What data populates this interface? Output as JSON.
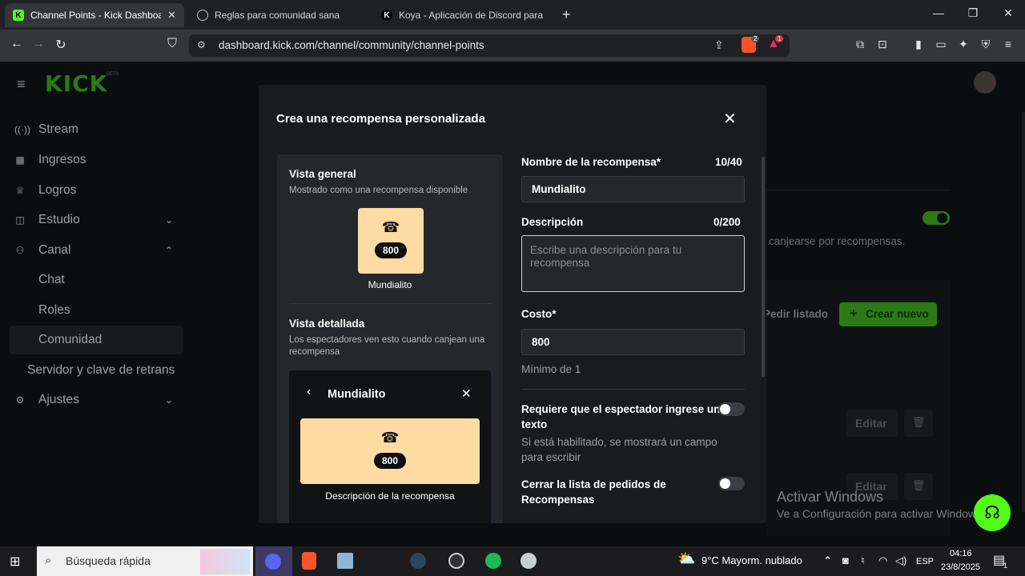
{
  "browser": {
    "tabs": [
      {
        "label": "Channel Points - Kick Dashboard",
        "favicon": "K",
        "active": true
      },
      {
        "label": "Reglas para comunidad sana",
        "favicon": "globe"
      },
      {
        "label": "Koya - Aplicación de Discord para la c",
        "favicon": "K"
      }
    ],
    "url": "dashboard.kick.com/channel/community/channel-points",
    "brave_badge": "2",
    "alert_badge": "1"
  },
  "sidebar": {
    "logo": "KICK",
    "logo_sup": "BETA",
    "items": [
      {
        "label": "Stream",
        "icon": "broadcast-icon"
      },
      {
        "label": "Ingresos",
        "icon": "chart-icon"
      },
      {
        "label": "Logros",
        "icon": "trophy-icon"
      },
      {
        "label": "Estudio",
        "icon": "studio-icon"
      },
      {
        "label": "Canal",
        "icon": "users-icon"
      },
      {
        "label": "Chat"
      },
      {
        "label": "Roles"
      },
      {
        "label": "Comunidad"
      },
      {
        "label": "Servidor y clave de retrans"
      },
      {
        "label": "Ajustes",
        "icon": "gear-icon"
      }
    ]
  },
  "background": {
    "redeem_text": "canjearse por recompensas.",
    "request_list_btn": "Pedir listado",
    "create_btn": "Crear nuevo",
    "edit_label": "Editar"
  },
  "modal": {
    "title": "Crea una recompensa personalizada",
    "overview_title": "Vista general",
    "overview_sub": "Mostrado como una recompensa disponible",
    "reward_cost": "800",
    "reward_name": "Mundialito",
    "detail_title": "Vista detallada",
    "detail_sub": "Los espectadores ven esto cuando canjean una recompensa",
    "detail_header": "Mundialito",
    "detail_desc": "Descripción de la recompensa",
    "name_label": "Nombre de la recompensa*",
    "name_counter": "10/40",
    "name_value": "Mundialito",
    "desc_label": "Descripción",
    "desc_counter": "0/200",
    "desc_placeholder": "Escribe una descripción para tu recompensa",
    "cost_label": "Costo*",
    "cost_value": "800",
    "cost_help": "Mínimo de 1",
    "require_text_label": "Requiere que el espectador ingrese un texto",
    "require_text_help": "Si está habilitado, se mostrará un campo para escribir",
    "close_list_label": "Cerrar la lista de pedidos de Recompensas"
  },
  "watermark": {
    "title": "Activar Windows",
    "sub": "Ve a Configuración para activar Windows."
  },
  "taskbar": {
    "search": "Búsqueda rápida",
    "weather": "9°C  Mayorm. nublado",
    "lang": "ESP",
    "time": "04:16",
    "date": "23/8/2025",
    "notif_count": "1"
  },
  "colors": {
    "kick_green": "#53fc18",
    "reward_card": "#fedba3"
  }
}
